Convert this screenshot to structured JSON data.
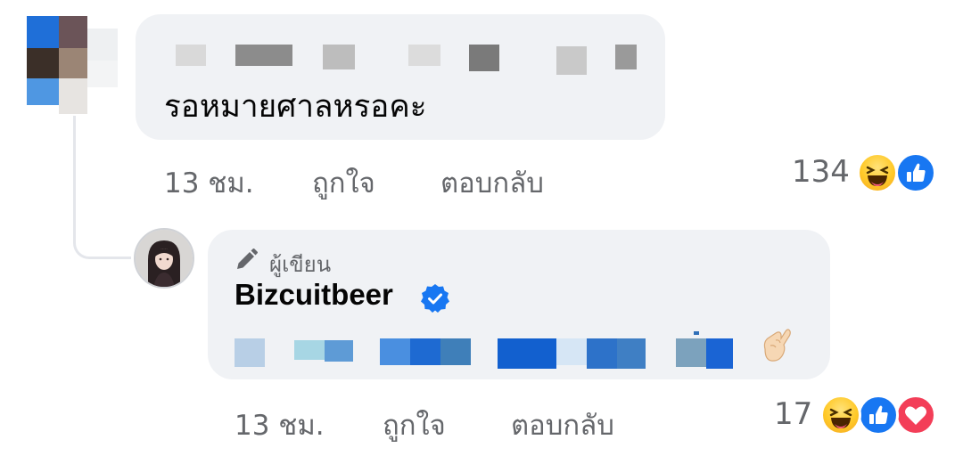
{
  "colors": {
    "bubble_bg": "#f0f2f5",
    "meta_text": "#65676b",
    "primary_text": "#050505",
    "facebook_blue": "#1877f2",
    "love_red": "#f33e58",
    "haha_yellow": "#ffc928"
  },
  "comment": {
    "author_avatar_icon": "blurred-avatar",
    "text": "รอหมายศาลหรอคะ",
    "time": "13 ชม.",
    "like_label": "ถูกใจ",
    "reply_label": "ตอบกลับ",
    "reaction_count": "134",
    "reactions": [
      "haha",
      "like"
    ]
  },
  "reply": {
    "avatar_icon": "profile-photo",
    "author_badge_icon": "pencil-icon",
    "author_badge": "ผู้เขียน",
    "author_name": "Bizcuitbeer",
    "verified_icon": "verified-badge-icon",
    "end_emoji": "finger-heart-emoji",
    "time": "13 ชม.",
    "like_label": "ถูกใจ",
    "reply_label": "ตอบกลับ",
    "reaction_count": "17",
    "reactions": [
      "haha",
      "like",
      "love"
    ]
  }
}
